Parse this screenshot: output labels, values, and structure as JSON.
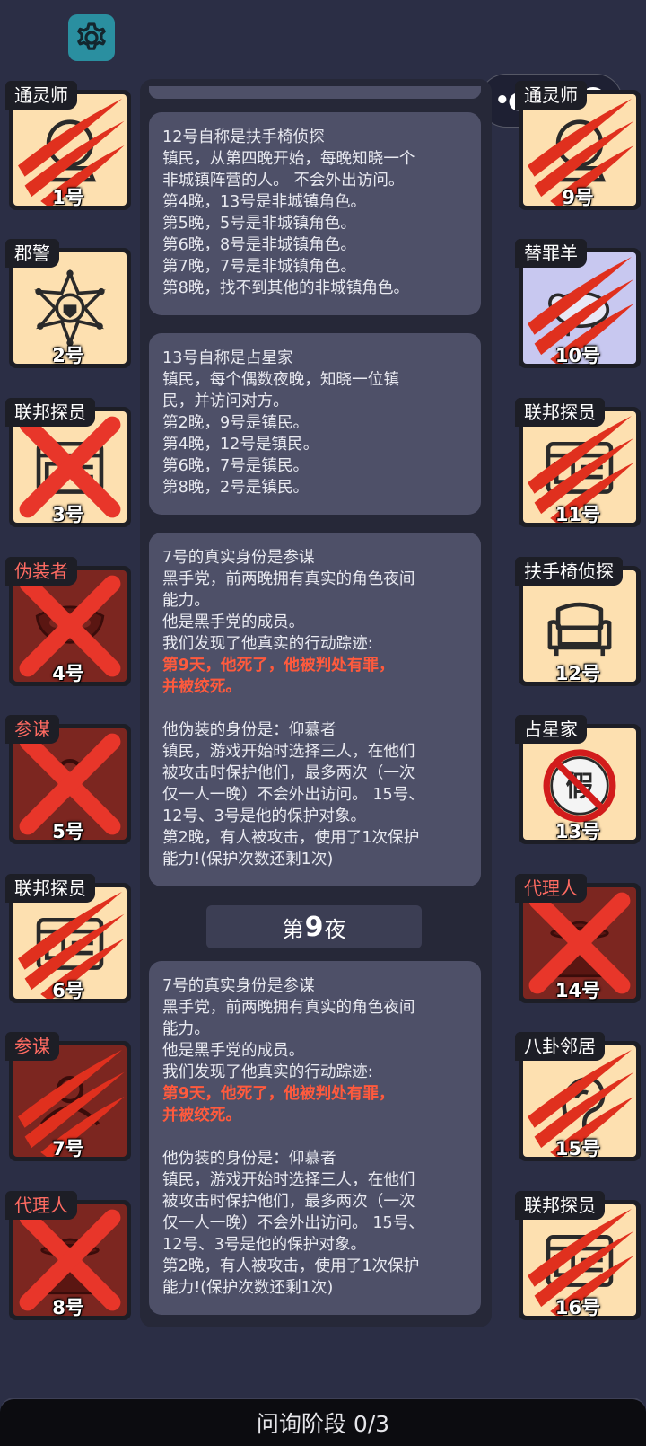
{
  "colors": {
    "background": "#2b2e45",
    "card_good": "#fde0b0",
    "card_evil": "#7c2620",
    "accent_red": "#ff5a3d",
    "settings": "#2a8fa0"
  },
  "header": {
    "settings_icon": "gear-icon",
    "capsule_menu_icon": "more-dots-icon",
    "capsule_close_icon": "target-circle-icon"
  },
  "players": [
    {
      "number": "1号",
      "role": "通灵师",
      "icon": "crystal-ball-icon",
      "status": "clawed",
      "faction": "town"
    },
    {
      "number": "2号",
      "role": "郡警",
      "icon": "sheriff-badge-icon",
      "status": "alive",
      "faction": "town"
    },
    {
      "number": "3号",
      "role": "联邦探员",
      "icon": "id-card-icon",
      "status": "crossed",
      "faction": "town"
    },
    {
      "number": "4号",
      "role": "伪装者",
      "icon": "mask-icon",
      "status": "crossed",
      "faction": "evil"
    },
    {
      "number": "5号",
      "role": "参谋",
      "icon": "strategist-icon",
      "status": "crossed",
      "faction": "evil"
    },
    {
      "number": "6号",
      "role": "联邦探员",
      "icon": "id-card-icon",
      "status": "clawed",
      "faction": "town"
    },
    {
      "number": "7号",
      "role": "参谋",
      "icon": "strategist-icon",
      "status": "clawed",
      "faction": "evil"
    },
    {
      "number": "8号",
      "role": "代理人",
      "icon": "agent-hat-icon",
      "status": "crossed",
      "faction": "evil"
    },
    {
      "number": "9号",
      "role": "通灵师",
      "icon": "crystal-ball-icon",
      "status": "clawed",
      "faction": "town"
    },
    {
      "number": "10号",
      "role": "替罪羊",
      "icon": "sheep-icon",
      "status": "clawed",
      "faction": "neutral"
    },
    {
      "number": "11号",
      "role": "联邦探员",
      "icon": "id-card-icon",
      "status": "clawed",
      "faction": "town"
    },
    {
      "number": "12号",
      "role": "扶手椅侦探",
      "icon": "armchair-icon",
      "status": "alive",
      "faction": "town"
    },
    {
      "number": "13号",
      "role": "占星家",
      "icon": "fake-seal-icon",
      "status": "alive",
      "faction": "town"
    },
    {
      "number": "14号",
      "role": "代理人",
      "icon": "agent-hat-icon",
      "status": "crossed",
      "faction": "evil"
    },
    {
      "number": "15号",
      "role": "八卦邻居",
      "icon": "gossip-ear-icon",
      "status": "clawed",
      "faction": "town"
    },
    {
      "number": "16号",
      "role": "联邦探员",
      "icon": "id-card-icon",
      "status": "clawed",
      "faction": "town"
    }
  ],
  "log": {
    "messages": [
      {
        "lines": [
          {
            "text": "12号自称是扶手椅侦探"
          },
          {
            "text": "镇民，从第四晚开始，每晚知晓一个"
          },
          {
            "text": "非城镇阵营的人。 不会外出访问。"
          },
          {
            "text": "第4晚，13号是非城镇角色。"
          },
          {
            "text": "第5晚，5号是非城镇角色。"
          },
          {
            "text": "第6晚，8号是非城镇角色。"
          },
          {
            "text": "第7晚，7号是非城镇角色。"
          },
          {
            "text": "第8晚，找不到其他的非城镇角色。"
          }
        ]
      },
      {
        "lines": [
          {
            "text": "13号自称是占星家"
          },
          {
            "text": "镇民，每个偶数夜晚，知晓一位镇"
          },
          {
            "text": "民，并访问对方。"
          },
          {
            "text": "第2晚，9号是镇民。"
          },
          {
            "text": "第4晚，12号是镇民。"
          },
          {
            "text": "第6晚，7号是镇民。"
          },
          {
            "text": "第8晚，2号是镇民。"
          }
        ]
      },
      {
        "lines": [
          {
            "text": "7号的真实身份是参谋"
          },
          {
            "text": "黑手党，前两晚拥有真实的角色夜间"
          },
          {
            "text": "能力。"
          },
          {
            "text": "他是黑手党的成员。"
          },
          {
            "text": "我们发现了他真实的行动踪迹:"
          },
          {
            "text": "第9天，他死了，他被判处有罪，",
            "red": true
          },
          {
            "text": "并被绞死。",
            "red": true
          },
          {
            "text": ""
          },
          {
            "text": "他伪装的身份是：仰慕者"
          },
          {
            "text": "镇民，游戏开始时选择三人，在他们"
          },
          {
            "text": "被攻击时保护他们，最多两次（一次"
          },
          {
            "text": "仅一人一晚）不会外出访问。 15号、"
          },
          {
            "text": "12号、3号是他的保护对象。"
          },
          {
            "text": "第2晚，有人被攻击，使用了1次保护"
          },
          {
            "text": "能力!(保护次数还剩1次)"
          }
        ]
      },
      {
        "lines": [
          {
            "text": "7号的真实身份是参谋"
          },
          {
            "text": "黑手党，前两晚拥有真实的角色夜间"
          },
          {
            "text": "能力。"
          },
          {
            "text": "他是黑手党的成员。"
          },
          {
            "text": "我们发现了他真实的行动踪迹:"
          },
          {
            "text": "第9天，他死了，他被判处有罪，",
            "red": true
          },
          {
            "text": "并被绞死。",
            "red": true
          },
          {
            "text": ""
          },
          {
            "text": "他伪装的身份是：仰慕者"
          },
          {
            "text": "镇民，游戏开始时选择三人，在他们"
          },
          {
            "text": "被攻击时保护他们，最多两次（一次"
          },
          {
            "text": "仅一人一晚）不会外出访问。 15号、"
          },
          {
            "text": "12号、3号是他的保护对象。"
          },
          {
            "text": "第2晚，有人被攻击，使用了1次保护"
          },
          {
            "text": "能力!(保护次数还剩1次)"
          }
        ]
      }
    ],
    "night_divider": {
      "prefix": "第",
      "number": "9",
      "suffix": "夜"
    }
  },
  "footer": {
    "phase_label": "问询阶段 0/3"
  }
}
